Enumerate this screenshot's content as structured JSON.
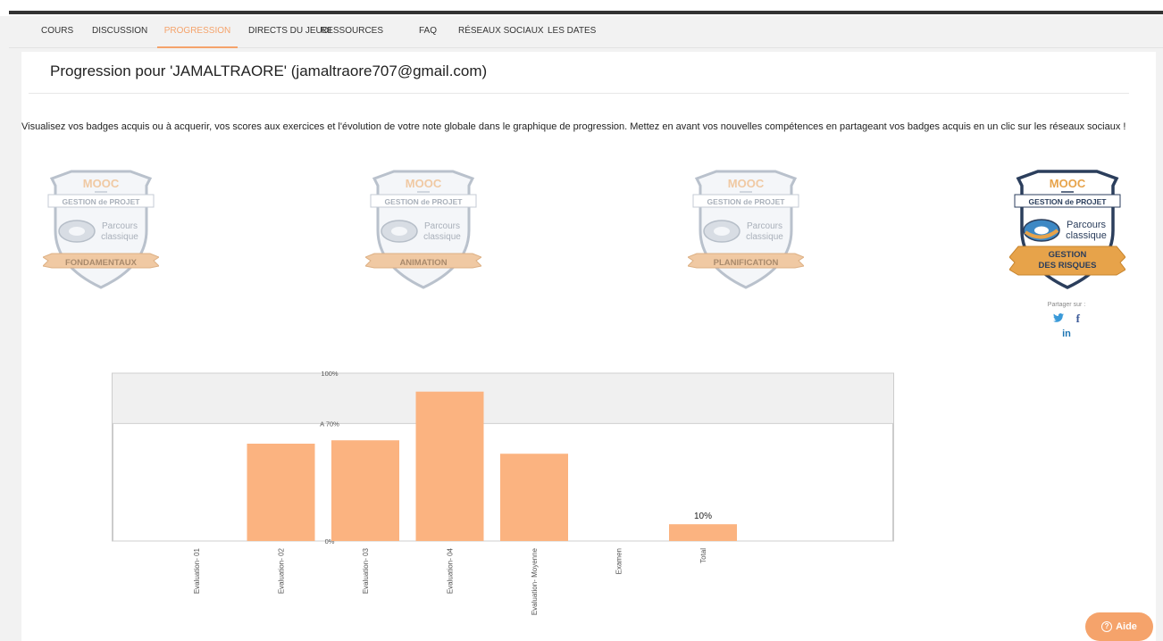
{
  "nav": {
    "items": [
      {
        "label": "COURS",
        "active": false
      },
      {
        "label": "DISCUSSION",
        "active": false
      },
      {
        "label": "PROGRESSION",
        "active": true
      },
      {
        "label": "DIRECTS DU JEUDI",
        "active": false
      },
      {
        "label": "RESSOURCES",
        "active": false
      },
      {
        "label": "FAQ",
        "active": false
      },
      {
        "label": "RÉSEAUX SOCIAUX",
        "active": false
      },
      {
        "label": "LES DATES",
        "active": false
      }
    ]
  },
  "page": {
    "title": "Progression pour 'JAMALTRAORE' (jamaltraore707@gmail.com)",
    "description": "Visualisez vos badges acquis ou à acquerir, vos scores aux exercices et l'évolution de votre note globale dans le graphique de progression. Mettez en avant vos nouvelles compétences en partageant vos badges acquis en un clic sur les réseaux sociaux !"
  },
  "badges": [
    {
      "top": "MOOC",
      "subtitle": "GESTION de PROJET",
      "parcours1": "Parcours",
      "parcours2": "classique",
      "ribbon": "FONDAMENTAUX",
      "earned": false
    },
    {
      "top": "MOOC",
      "subtitle": "GESTION de PROJET",
      "parcours1": "Parcours",
      "parcours2": "classique",
      "ribbon": "ANIMATION",
      "earned": false
    },
    {
      "top": "MOOC",
      "subtitle": "GESTION de PROJET",
      "parcours1": "Parcours",
      "parcours2": "classique",
      "ribbon": "PLANIFICATION",
      "earned": false
    },
    {
      "top": "MOOC",
      "subtitle": "GESTION de PROJET",
      "parcours1": "Parcours",
      "parcours2": "classique",
      "ribbon": "GESTION",
      "ribbon2": "DES RISQUES",
      "earned": true
    }
  ],
  "share": {
    "label": "Partager sur :",
    "icons": [
      "twitter-icon",
      "facebook-icon",
      "linkedin-icon"
    ]
  },
  "help": {
    "label": "Aide"
  },
  "colors": {
    "accent": "#f5a36b",
    "bar": "#fbb380",
    "badge_gold": "#e7a34a",
    "badge_navy": "#2b3e5c"
  },
  "chart_data": {
    "type": "bar",
    "categories": [
      "Evaluation- 01",
      "Evaluation- 02",
      "Evaluation- 03",
      "Evaluation- 04",
      "Evaluation- Moyenne",
      "Examen",
      "Total"
    ],
    "values": [
      0,
      58,
      60,
      89,
      52,
      0,
      10
    ],
    "ylim": [
      0,
      100
    ],
    "gridlines": [
      {
        "value": 100,
        "label": "100%"
      },
      {
        "value": 70,
        "label": "A 70%"
      },
      {
        "value": 0,
        "label": "0%"
      }
    ],
    "data_labels": [
      {
        "index": 6,
        "label": "10%"
      }
    ],
    "shaded_band": [
      70,
      100
    ]
  }
}
